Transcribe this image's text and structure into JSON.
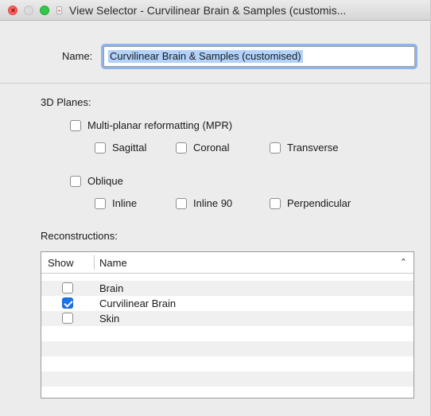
{
  "window": {
    "title": "View Selector - Curvilinear Brain & Samples (customis..."
  },
  "name_field": {
    "label": "Name:",
    "value": "Curvilinear Brain & Samples (customised)"
  },
  "planes": {
    "section_label": "3D Planes:",
    "mpr": {
      "label": "Multi-planar reformatting (MPR)",
      "checked": false,
      "options": [
        {
          "label": "Sagittal",
          "checked": false
        },
        {
          "label": "Coronal",
          "checked": false
        },
        {
          "label": "Transverse",
          "checked": false
        }
      ]
    },
    "oblique": {
      "label": "Oblique",
      "checked": false,
      "options": [
        {
          "label": "Inline",
          "checked": false
        },
        {
          "label": "Inline 90",
          "checked": false
        },
        {
          "label": "Perpendicular",
          "checked": false
        }
      ]
    }
  },
  "reconstructions": {
    "section_label": "Reconstructions:",
    "columns": [
      "Show",
      "Name"
    ],
    "sort_icon": "chevron-up-icon",
    "rows": [
      {
        "name": "Brain",
        "show": false
      },
      {
        "name": "Curvilinear Brain",
        "show": true
      },
      {
        "name": "Skin",
        "show": false
      }
    ]
  },
  "colors": {
    "accent": "#1a73e8",
    "selection": "#b3d2fa",
    "focus_ring": "#8fb4ea"
  }
}
